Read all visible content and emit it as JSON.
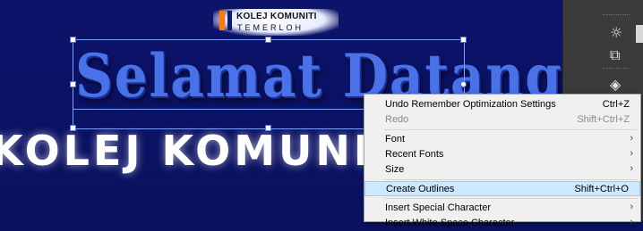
{
  "logo": {
    "line1": "KOLEJ KOMUNITI",
    "line2": "TEMERLOH"
  },
  "headline": "Selamat Datang",
  "subtitle": "KOLEJ KOMUNITI TE",
  "panel": {
    "icons": [
      "sun-icon",
      "export-icon",
      "layers-icon",
      "layers-small-icon"
    ]
  },
  "context_menu": {
    "items": [
      {
        "label": "Undo Remember Optimization Settings",
        "shortcut": "Ctrl+Z"
      },
      {
        "label": "Redo",
        "shortcut": "Shift+Ctrl+Z",
        "disabled": true
      },
      {
        "label": "Font",
        "submenu": true
      },
      {
        "label": "Recent Fonts",
        "submenu": true
      },
      {
        "label": "Size",
        "submenu": true
      },
      {
        "label": "Create Outlines",
        "shortcut": "Shift+Ctrl+O",
        "highlighted": true
      },
      {
        "label": "Insert Special Character",
        "submenu": true
      },
      {
        "label": "Insert White Space Character",
        "submenu": true
      }
    ],
    "arrow_glyph": "›"
  },
  "colors": {
    "canvas_bg": "#0a1260",
    "headline": "#4a72e8",
    "menu_highlight": "#cde8ff"
  }
}
